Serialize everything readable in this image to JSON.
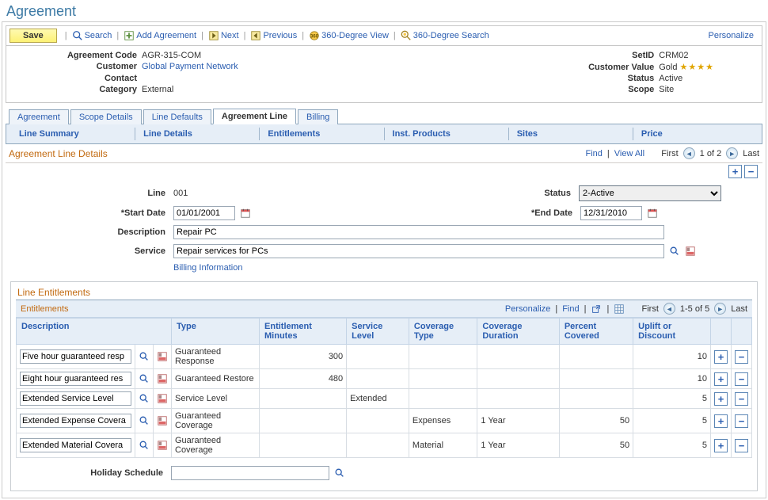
{
  "page": {
    "title": "Agreement"
  },
  "toolbar": {
    "save": "Save",
    "search": "Search",
    "add_agreement": "Add Agreement",
    "next": "Next",
    "previous": "Previous",
    "degree_view": "360-Degree View",
    "degree_search": "360-Degree Search",
    "personalize": "Personalize"
  },
  "header": {
    "agreement_code_label": "Agreement Code",
    "agreement_code": "AGR-315-COM",
    "customer_label": "Customer",
    "customer": "Global Payment Network",
    "contact_label": "Contact",
    "contact": "",
    "category_label": "Category",
    "category": "External",
    "setid_label": "SetID",
    "setid": "CRM02",
    "customer_value_label": "Customer Value",
    "customer_value": "Gold",
    "status_label": "Status",
    "status": "Active",
    "scope_label": "Scope",
    "scope": "Site"
  },
  "tabs": {
    "agreement": "Agreement",
    "scope_details": "Scope Details",
    "line_defaults": "Line Defaults",
    "agreement_line": "Agreement Line",
    "billing": "Billing"
  },
  "subtabs": {
    "line_summary": "Line Summary",
    "line_details": "Line Details",
    "entitlements": "Entitlements",
    "inst_products": "Inst. Products",
    "sites": "Sites",
    "price": "Price"
  },
  "section": {
    "title": "Agreement Line Details",
    "find": "Find",
    "view_all": "View All",
    "first": "First",
    "pager": "1 of 2",
    "last": "Last"
  },
  "line": {
    "line_label": "Line",
    "line": "001",
    "status_label": "Status",
    "status_value": "2-Active",
    "start_date_label": "*Start Date",
    "start_date": "01/01/2001",
    "end_date_label": "*End Date",
    "end_date": "12/31/2010",
    "description_label": "Description",
    "description": "Repair PC",
    "service_label": "Service",
    "service": "Repair services for PCs",
    "billing_info": "Billing Information",
    "holiday_label": "Holiday Schedule",
    "holiday": ""
  },
  "entitlements_box": {
    "title": "Line Entitlements",
    "grid_title": "Entitlements",
    "personalize": "Personalize",
    "find": "Find",
    "first": "First",
    "pager": "1-5 of 5",
    "last": "Last",
    "cols": {
      "description": "Description",
      "type": "Type",
      "ent_min": "Entitlement Minutes",
      "svc_lvl": "Service Level",
      "cov_type": "Coverage Type",
      "cov_dur": "Coverage Duration",
      "pct_cov": "Percent Covered",
      "uplift": "Uplift or Discount"
    },
    "rows": [
      {
        "desc": "Five hour guaranteed resp",
        "type": "Guaranteed Response",
        "min": "300",
        "svc": "",
        "ctype": "",
        "cdur": "",
        "pct": "",
        "up": "10"
      },
      {
        "desc": "Eight hour guaranteed res",
        "type": "Guaranteed Restore",
        "min": "480",
        "svc": "",
        "ctype": "",
        "cdur": "",
        "pct": "",
        "up": "10"
      },
      {
        "desc": "Extended Service Level",
        "type": "Service Level",
        "min": "",
        "svc": "Extended",
        "ctype": "",
        "cdur": "",
        "pct": "",
        "up": "5"
      },
      {
        "desc": "Extended Expense Covera",
        "type": "Guaranteed Coverage",
        "min": "",
        "svc": "",
        "ctype": "Expenses",
        "cdur": "1 Year",
        "pct": "50",
        "up": "5"
      },
      {
        "desc": "Extended Material Covera",
        "type": "Guaranteed Coverage",
        "min": "",
        "svc": "",
        "ctype": "Material",
        "cdur": "1 Year",
        "pct": "50",
        "up": "5"
      }
    ]
  }
}
